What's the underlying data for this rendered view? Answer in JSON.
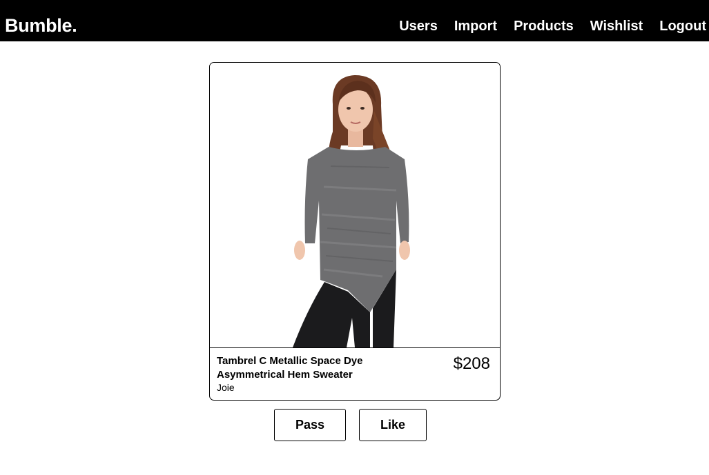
{
  "brand": {
    "name": "Bumble."
  },
  "nav": {
    "items": [
      "Users",
      "Import",
      "Products",
      "Wishlist",
      "Logout"
    ]
  },
  "product": {
    "name": "Tambrel C Metallic Space Dye Asymmetrical Hem Sweater",
    "brand": "Joie",
    "price": "$208",
    "image_icon": "product-photo-model-gray-sweater"
  },
  "actions": {
    "pass_label": "Pass",
    "like_label": "Like"
  },
  "colors": {
    "header_bg": "#000000",
    "header_text": "#ffffff",
    "sweater": "#6e6e70"
  }
}
